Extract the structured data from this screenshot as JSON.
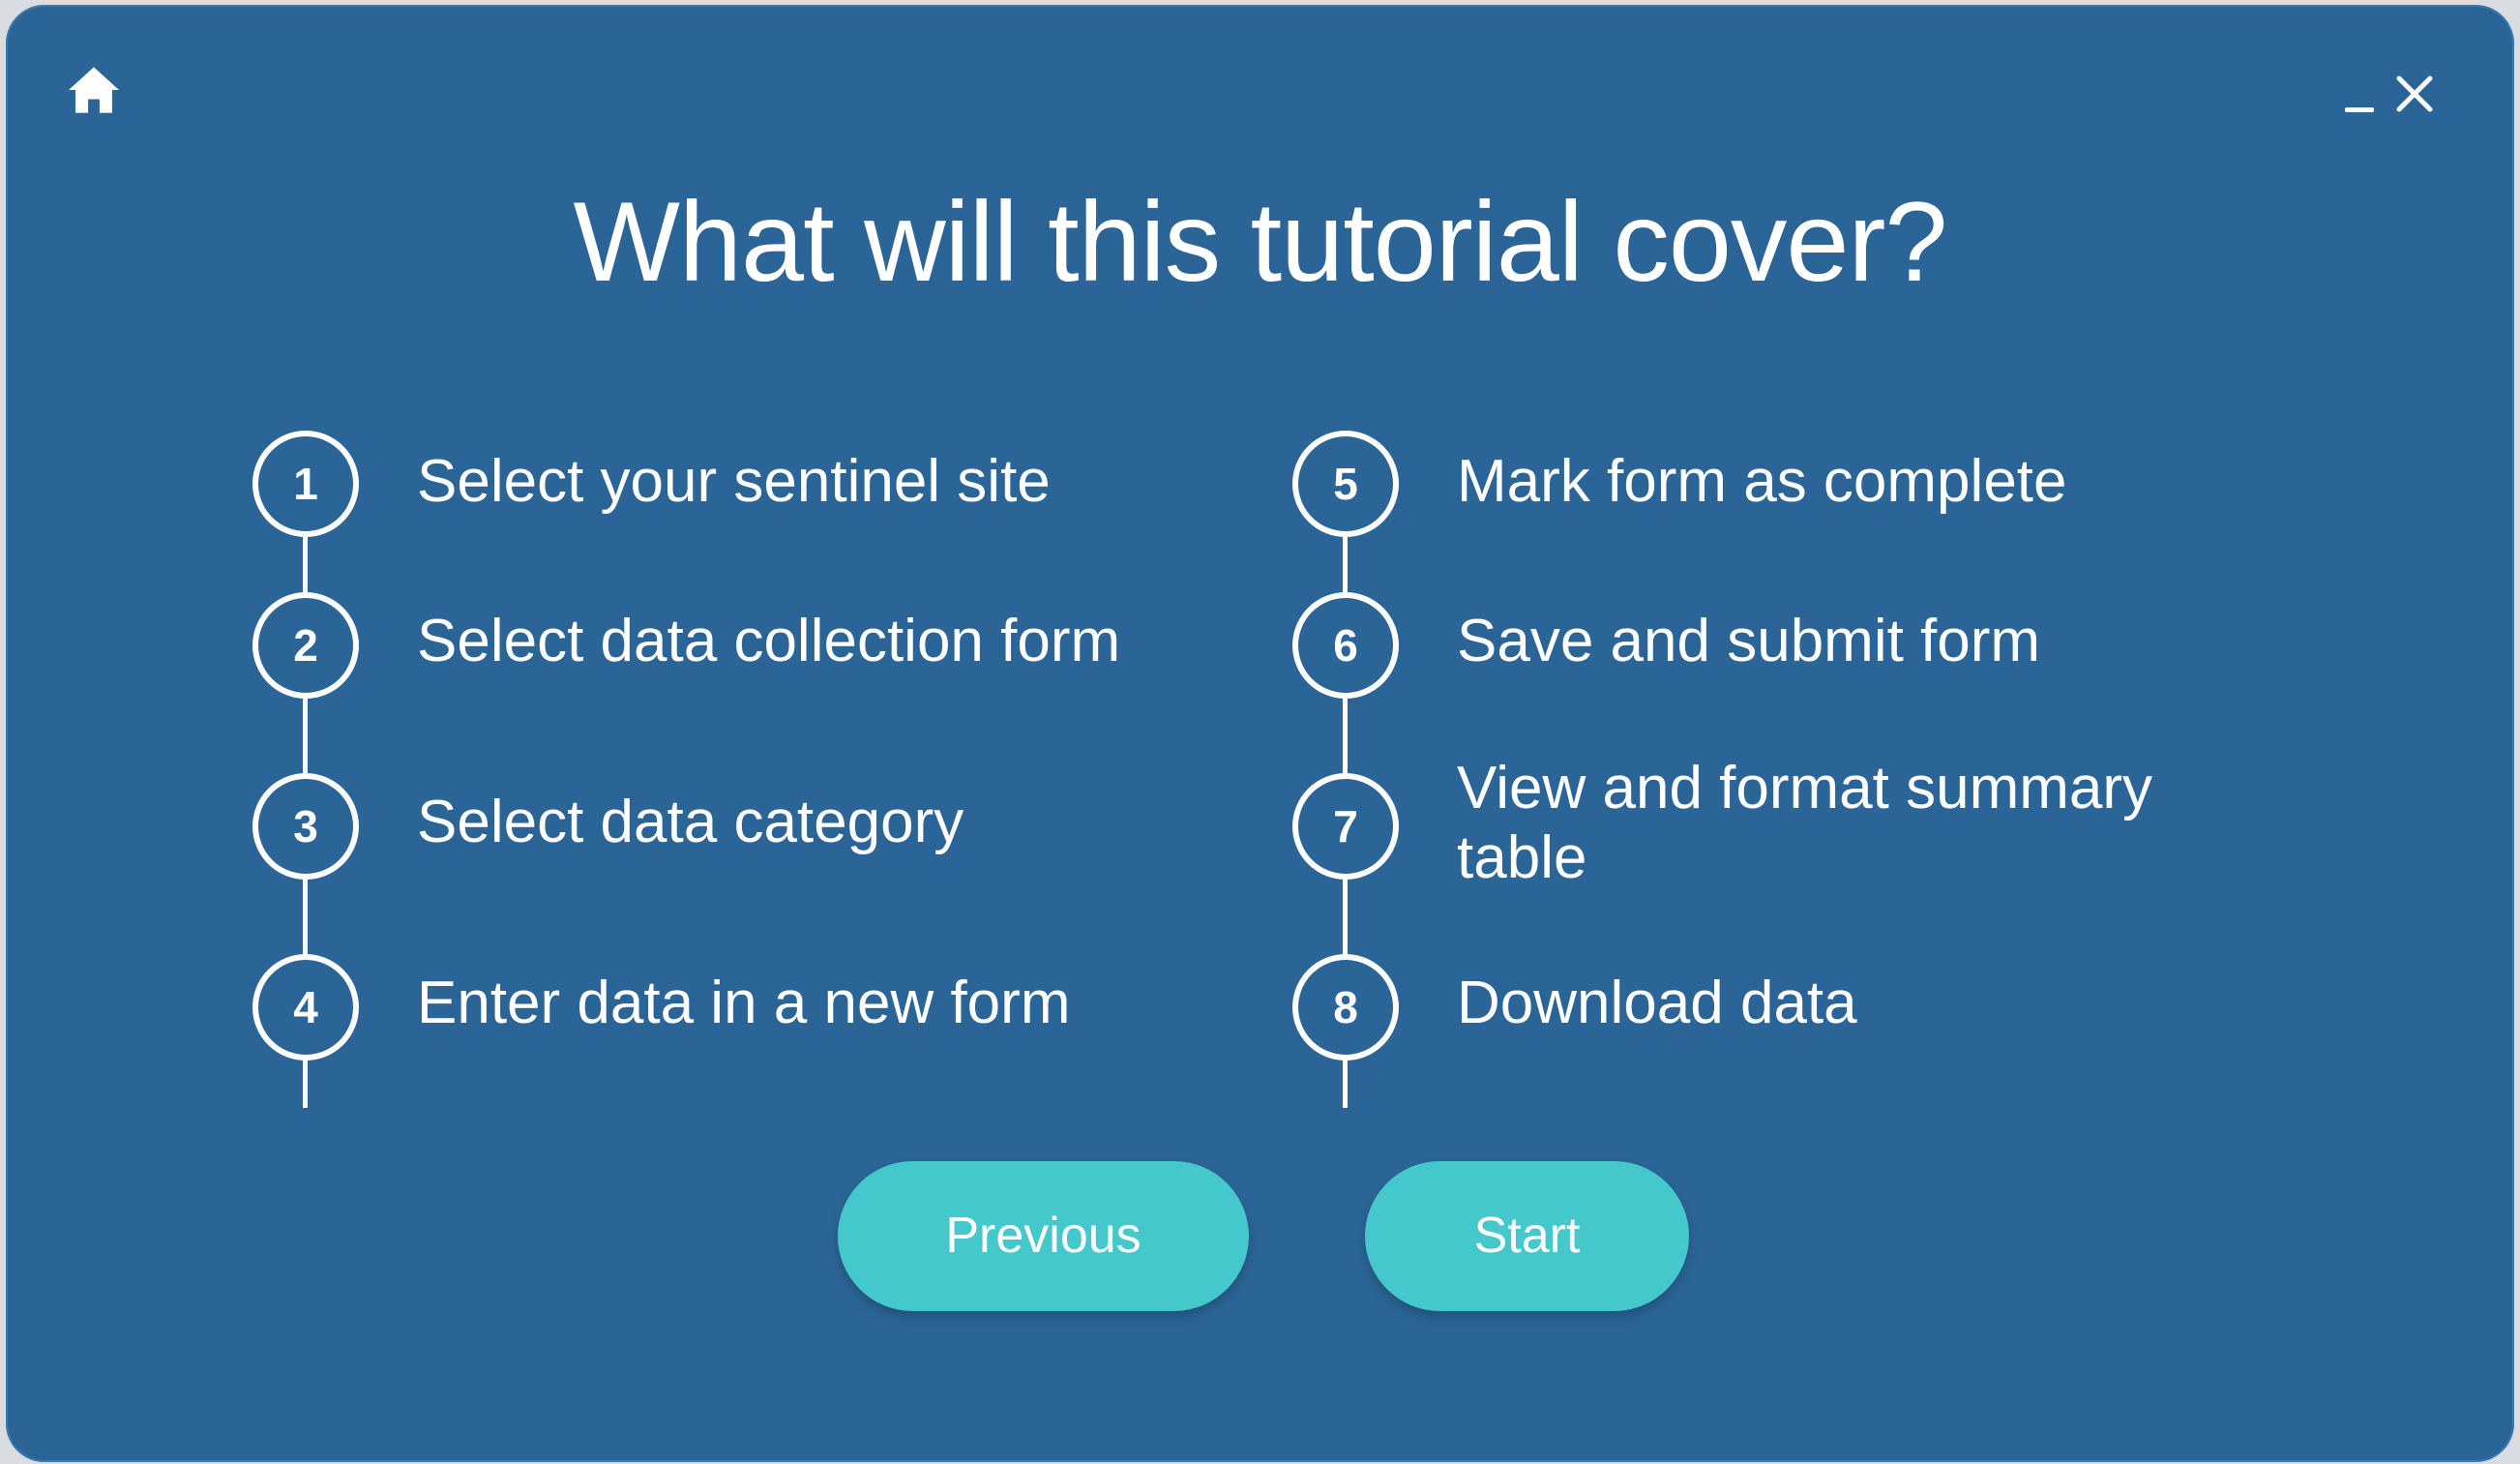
{
  "window": {
    "title": "What will this tutorial cover?",
    "icons": {
      "home": "home-icon",
      "minimize": "minimize-icon",
      "close": "close-icon"
    },
    "colors": {
      "background": "#2b6496",
      "accent": "#45c8cb",
      "text": "#ffffff"
    }
  },
  "steps": [
    {
      "number": "1",
      "label": "Select your sentinel site"
    },
    {
      "number": "2",
      "label": "Select data collection form"
    },
    {
      "number": "3",
      "label": "Select data category"
    },
    {
      "number": "4",
      "label": "Enter data in a new form"
    },
    {
      "number": "5",
      "label": "Mark form as complete"
    },
    {
      "number": "6",
      "label": "Save and submit form"
    },
    {
      "number": "7",
      "label": "View and format summary table"
    },
    {
      "number": "8",
      "label": "Download data"
    }
  ],
  "buttons": {
    "previous_label": "Previous",
    "start_label": "Start"
  }
}
